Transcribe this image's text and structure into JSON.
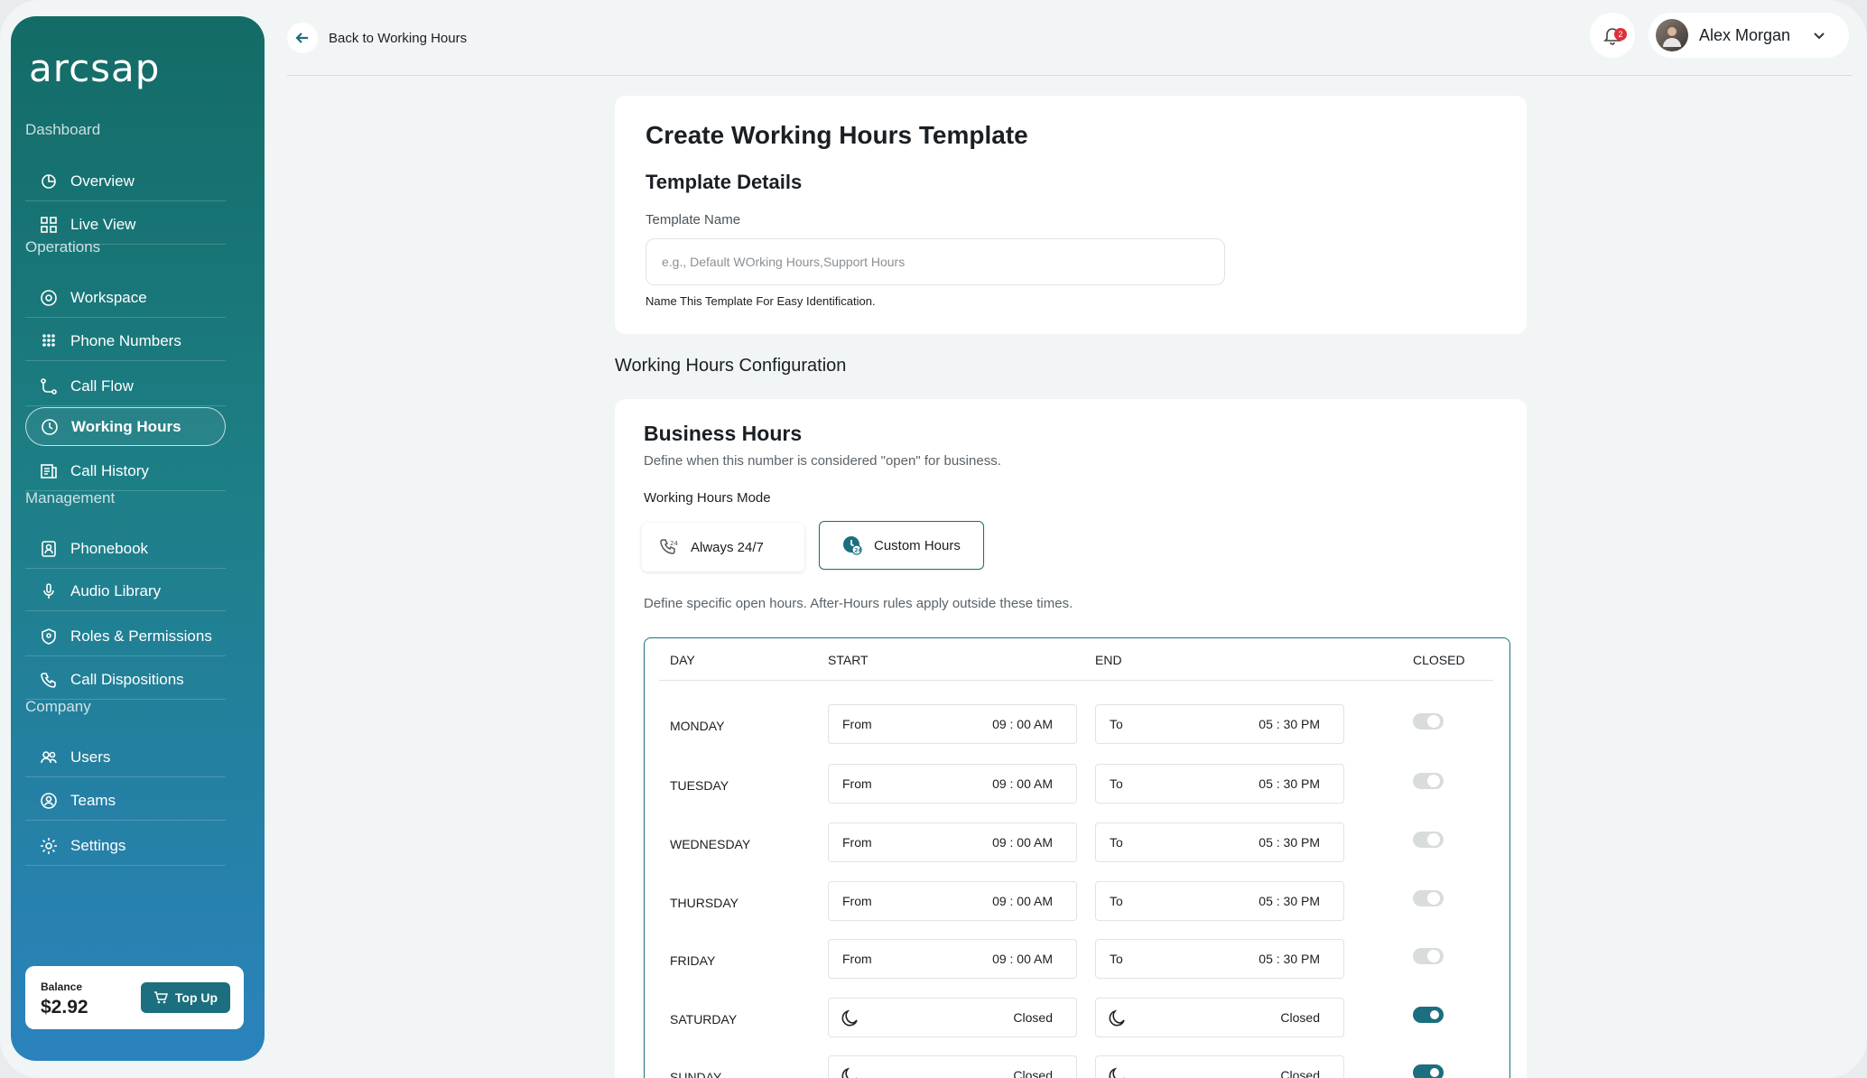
{
  "sidebar": {
    "logo_text": "arcsap",
    "sections": [
      "Dashboard",
      "Operations",
      "Management",
      "Company"
    ],
    "items": [
      {
        "label": "Overview",
        "icon": "overview-icon"
      },
      {
        "label": "Live View",
        "icon": "grid-icon"
      },
      {
        "label": "Workspace",
        "icon": "workspace-icon"
      },
      {
        "label": "Phone Numbers",
        "icon": "dialpad-icon"
      },
      {
        "label": "Call Flow",
        "icon": "flow-icon"
      },
      {
        "label": "Working Hours",
        "icon": "clock-icon",
        "active": true
      },
      {
        "label": "Call History",
        "icon": "history-icon"
      },
      {
        "label": "Phonebook",
        "icon": "phonebook-icon"
      },
      {
        "label": "Audio Library",
        "icon": "microphone-icon"
      },
      {
        "label": "Roles & Permissions",
        "icon": "shield-icon"
      },
      {
        "label": "Call Dispositions",
        "icon": "phone-icon"
      },
      {
        "label": "Users",
        "icon": "users-icon"
      },
      {
        "label": "Teams",
        "icon": "teams-icon"
      },
      {
        "label": "Settings",
        "icon": "gear-icon"
      }
    ],
    "balance": {
      "label": "Balance",
      "amount": "$2.92",
      "topup_label": "Top Up"
    }
  },
  "header": {
    "back_label": "Back to Working Hours",
    "notification_count": "2",
    "user_name": "Alex Morgan"
  },
  "template": {
    "title": "Create Working Hours Template",
    "subtitle": "Template Details",
    "name_label": "Template Name",
    "name_placeholder": "e.g., Default WOrking Hours,Support Hours",
    "name_value": "",
    "help_text": "Name This Template For Easy Identification."
  },
  "config": {
    "section_title": "Working Hours Configuration",
    "title": "Business Hours",
    "description": "Define when this number is considered \"open\" for business.",
    "mode_label": "Working Hours Mode",
    "modes": [
      {
        "label": "Always 24/7",
        "selected": false
      },
      {
        "label": "Custom Hours",
        "selected": true
      }
    ],
    "custom_description": "Define specific open hours. After-Hours rules apply outside these times.",
    "table": {
      "headers": [
        "DAY",
        "START",
        "END",
        "CLOSED"
      ],
      "rows": [
        {
          "day": "MONDAY",
          "from_label": "From",
          "start": "09 : 00 AM",
          "to_label": "To",
          "end": "05 : 30 PM",
          "closed": false
        },
        {
          "day": "TUESDAY",
          "from_label": "From",
          "start": "09 : 00 AM",
          "to_label": "To",
          "end": "05 : 30 PM",
          "closed": false
        },
        {
          "day": "WEDNESDAY",
          "from_label": "From",
          "start": "09 : 00 AM",
          "to_label": "To",
          "end": "05 : 30 PM",
          "closed": false
        },
        {
          "day": "THURSDAY",
          "from_label": "From",
          "start": "09 : 00 AM",
          "to_label": "To",
          "end": "05 : 30 PM",
          "closed": false
        },
        {
          "day": "FRIDAY",
          "from_label": "From",
          "start": "09 : 00 AM",
          "to_label": "To",
          "end": "05 : 30 PM",
          "closed": false
        },
        {
          "day": "SATURDAY",
          "start": "Closed",
          "end": "Closed",
          "closed": true
        },
        {
          "day": "SUNDAY",
          "start": "Closed",
          "end": "Closed",
          "closed": true
        }
      ]
    }
  },
  "colors": {
    "accent": "#1b6f7e",
    "sidebar_top": "#136b66",
    "sidebar_bottom": "#2b82bd",
    "badge": "#e0303a"
  }
}
